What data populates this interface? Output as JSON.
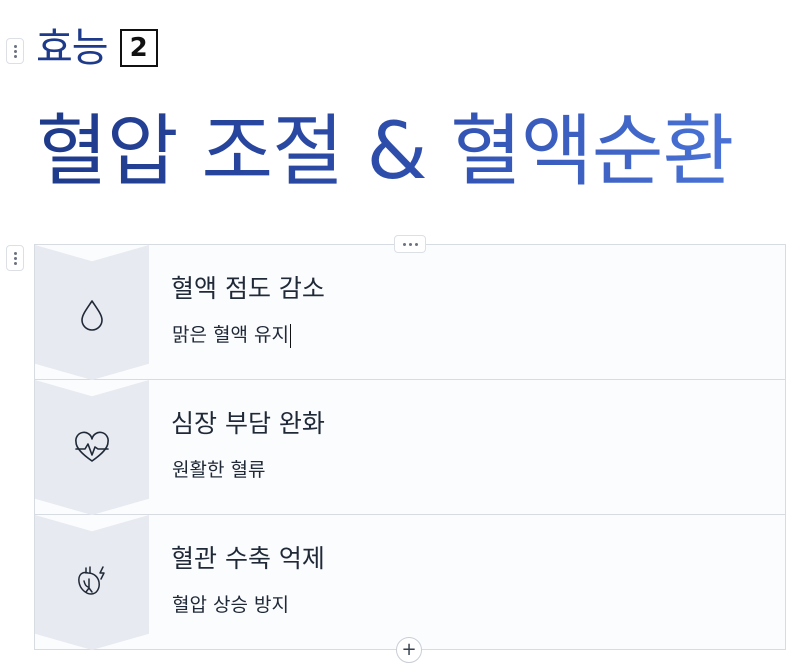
{
  "header": {
    "label": "효능",
    "badge_number": "2"
  },
  "headline": "혈압 조절 & 혈액순환",
  "benefits": [
    {
      "icon": "water-drop-icon",
      "title": "혈액 점도 감소",
      "description": "맑은 혈액 유지"
    },
    {
      "icon": "heartbeat-icon",
      "title": "심장 부담 완화",
      "description": "원활한 혈류"
    },
    {
      "icon": "heart-vessel-icon",
      "title": "혈관 수축 억제",
      "description": "혈압 상승 방지"
    }
  ],
  "colors": {
    "accent_dark": "#1e3a8a",
    "accent_light": "#4a72d6",
    "chevron_fill": "#e8eaf1",
    "border": "#d7dbe2"
  }
}
